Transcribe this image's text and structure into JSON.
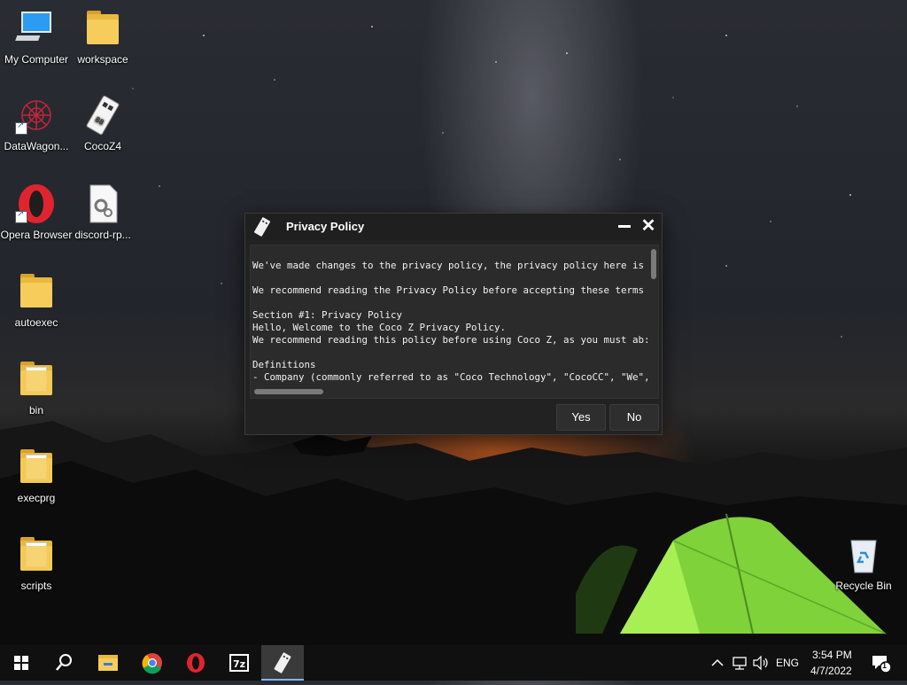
{
  "desktop": {
    "icons": [
      {
        "label": "My Computer",
        "icon": "computer-icon"
      },
      {
        "label": "workspace",
        "icon": "folder-icon"
      },
      {
        "label": "DataWagon...",
        "icon": "datawagon-icon"
      },
      {
        "label": "CocoZ4",
        "icon": "cocoz4-icon"
      },
      {
        "label": "Opera Browser",
        "icon": "opera-icon"
      },
      {
        "label": "discord-rp...",
        "icon": "file-icon"
      },
      {
        "label": "autoexec",
        "icon": "folder-icon"
      },
      {
        "label": "bin",
        "icon": "folder-icon"
      },
      {
        "label": "execprg",
        "icon": "folder-icon"
      },
      {
        "label": "scripts",
        "icon": "folder-icon"
      },
      {
        "label": "Recycle Bin",
        "icon": "recycle-bin-icon"
      }
    ]
  },
  "dialog": {
    "title": "Privacy Policy",
    "lines": [
      "We've made changes to the privacy policy, the privacy policy here is",
      "",
      "We recommend reading the Privacy Policy before accepting these terms",
      "",
      "Section #1: Privacy Policy",
      "Hello, Welcome to the Coco Z Privacy Policy.",
      "We recommend reading this policy before using Coco Z, as you must ab:",
      "",
      "Definitions",
      "- Company (commonly referred to as \"Coco Technology\", \"CocoCC\", \"We\","
    ],
    "yes_label": "Yes",
    "no_label": "No"
  },
  "taskbar": {
    "items": [
      "start-icon",
      "search-icon",
      "file-explorer-icon",
      "chrome-icon",
      "opera-icon",
      "7zip-icon",
      "cocoz4-icon"
    ],
    "active": "cocoz4-icon",
    "tray": {
      "language": "ENG",
      "time": "3:54 PM",
      "date": "4/7/2022",
      "notification_count": "1"
    }
  }
}
